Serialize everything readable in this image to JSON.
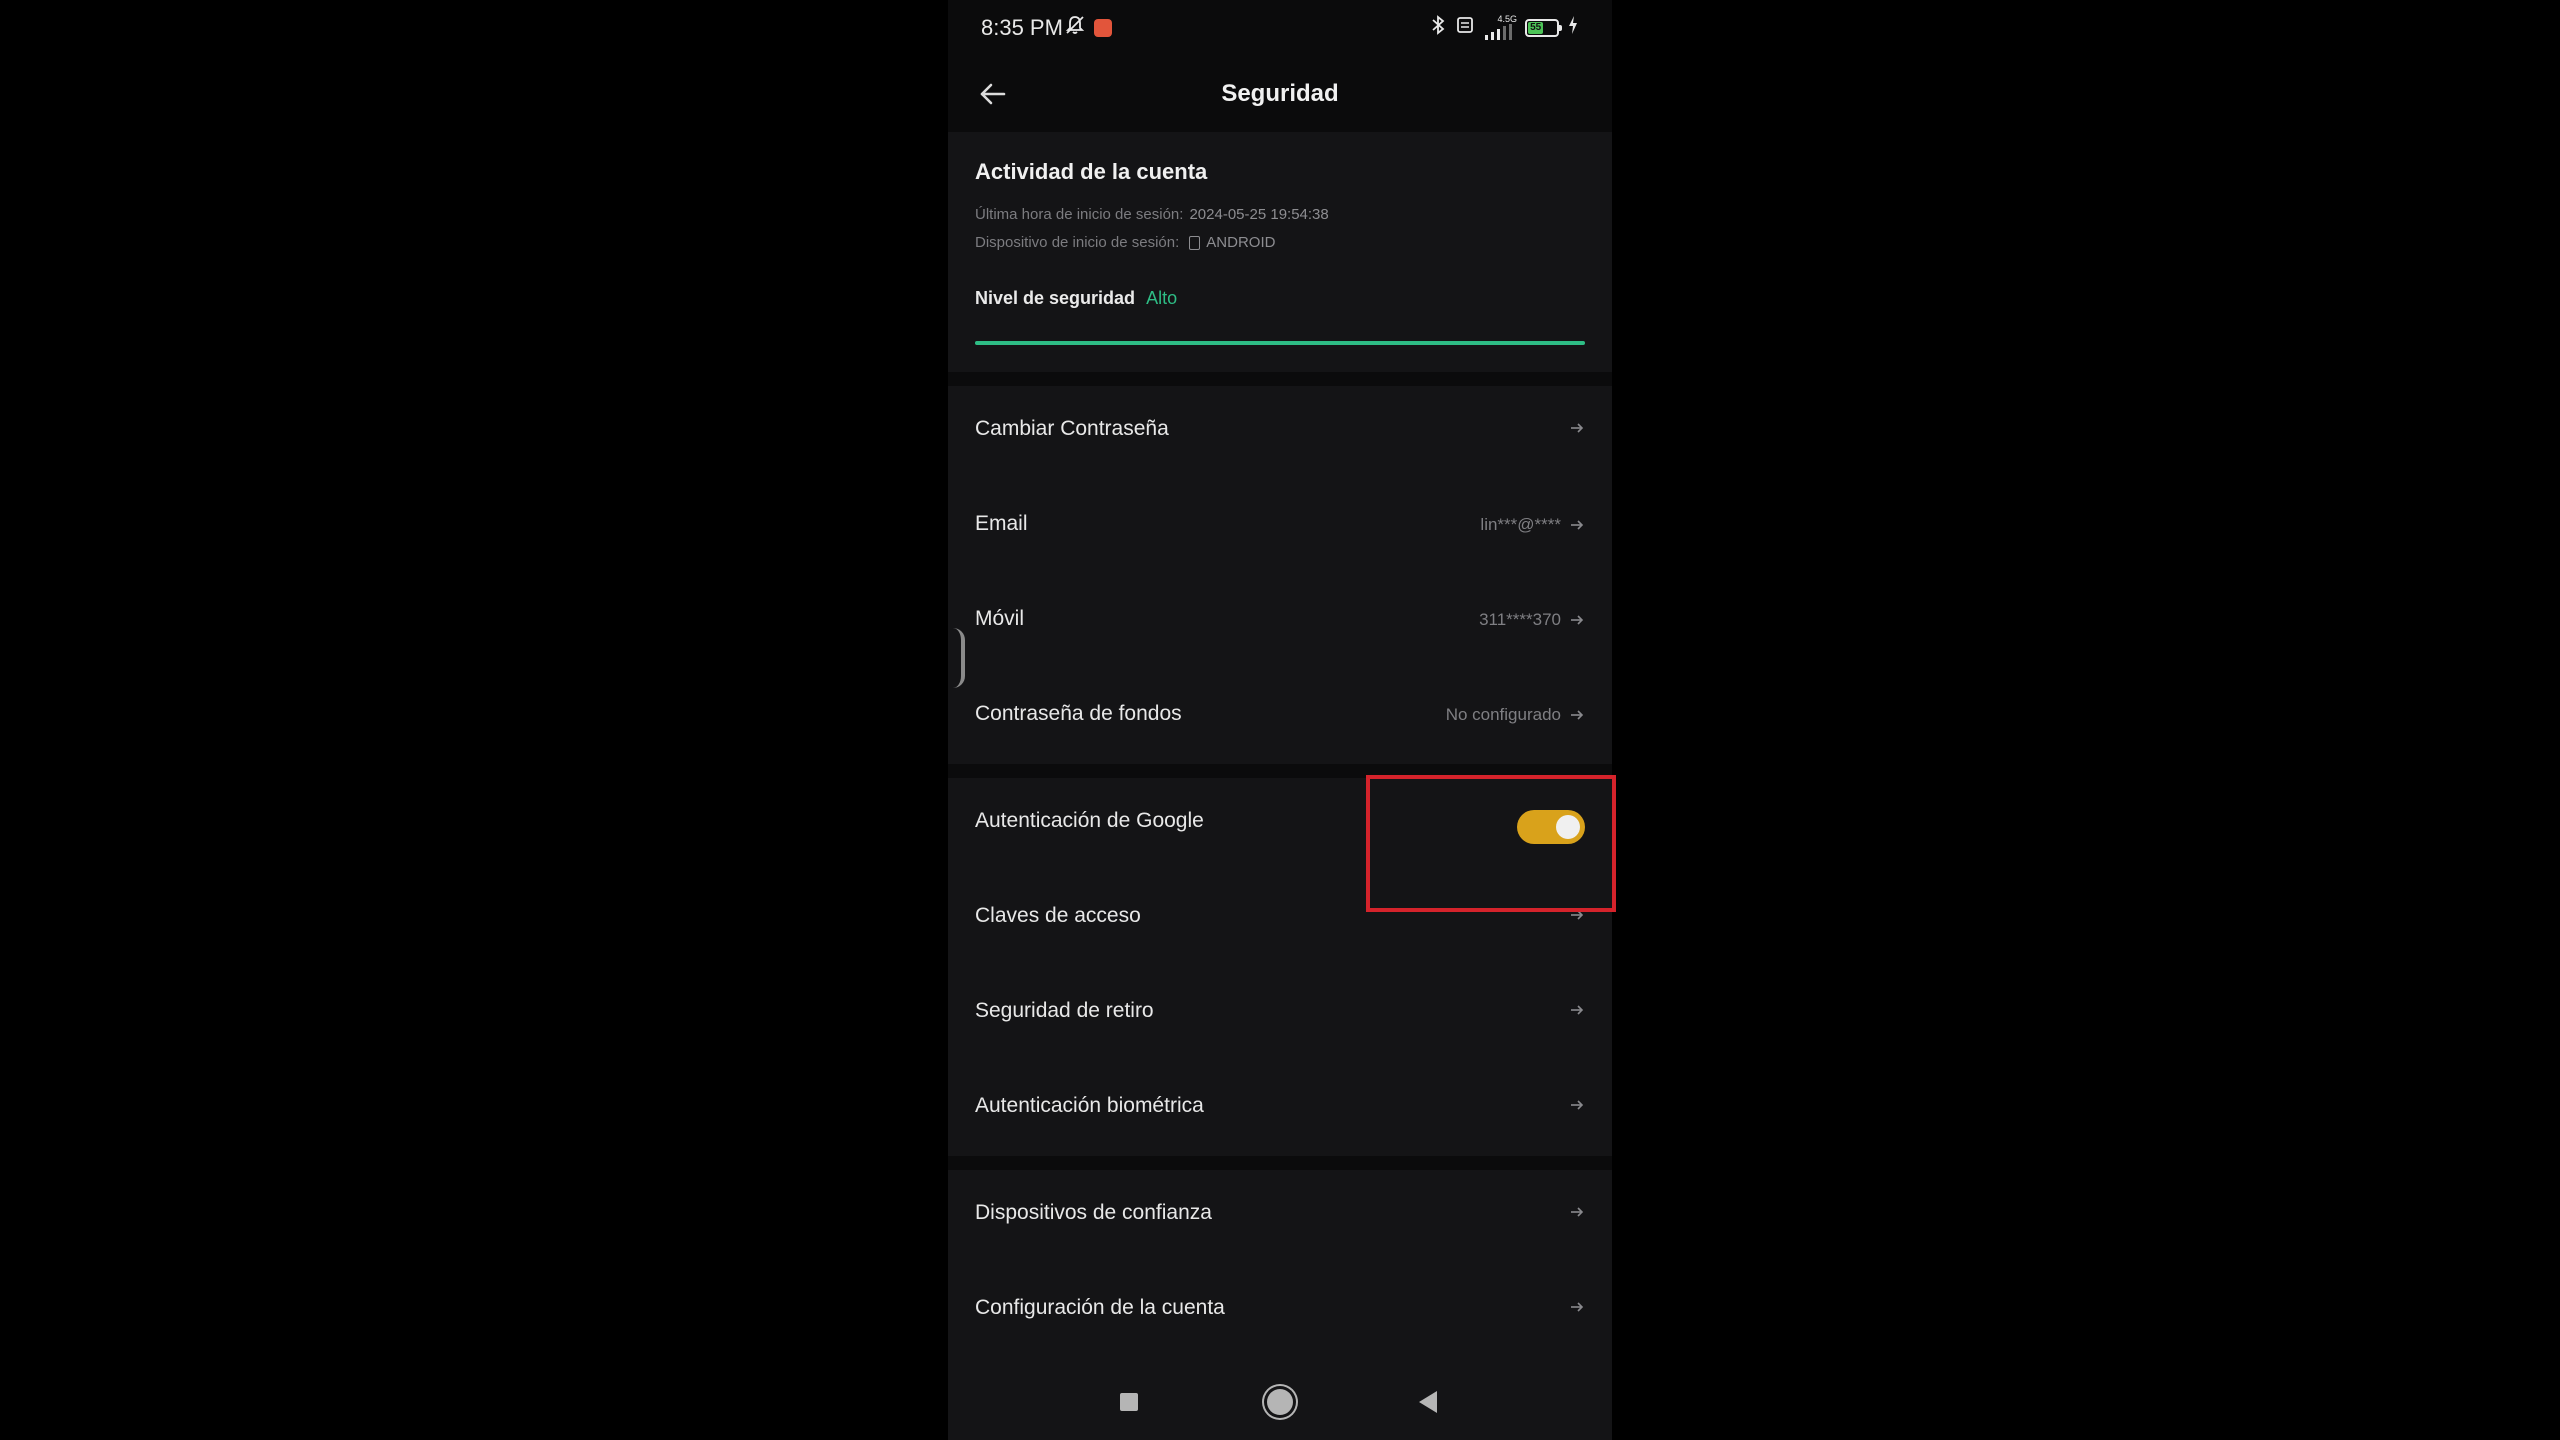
{
  "status_bar": {
    "time": "8:35 PM",
    "network": "4.5G",
    "battery": "55",
    "icons": [
      "mute-bell-icon",
      "recording-icon",
      "bluetooth-icon",
      "vibrate-icon",
      "signal-icon",
      "battery-icon",
      "charging-icon"
    ]
  },
  "header": {
    "title": "Seguridad",
    "back_icon": "arrow-left-icon"
  },
  "activity": {
    "title": "Actividad de la cuenta",
    "last_login_label": "Última hora de inicio de sesión:",
    "last_login_value": "2024-05-25 19:54:38",
    "device_label": "Dispositivo de inicio de sesión:",
    "device_value": "ANDROID",
    "security_level_label": "Nivel de seguridad",
    "security_level_value": "Alto",
    "security_level_progress": 1.0,
    "accent_color": "#2ebd85"
  },
  "group1": [
    {
      "label": "Cambiar Contraseña",
      "value": ""
    },
    {
      "label": "Email",
      "value": "lin***@****"
    },
    {
      "label": "Móvil",
      "value": "311****370"
    },
    {
      "label": "Contraseña de fondos",
      "value": "No configurado"
    }
  ],
  "group2": {
    "google_auth": {
      "label": "Autenticación de Google",
      "enabled": true,
      "toggle_color": "#d9a21b"
    },
    "items": [
      {
        "label": "Claves de acceso"
      },
      {
        "label": "Seguridad de retiro"
      },
      {
        "label": "Autenticación biométrica"
      }
    ]
  },
  "group3": [
    {
      "label": "Dispositivos de confianza"
    },
    {
      "label": "Configuración de la cuenta"
    }
  ],
  "annotation": {
    "color": "#d5232b"
  },
  "nav_bar": {
    "icons": [
      "recents-square-icon",
      "home-circle-icon",
      "back-triangle-icon"
    ]
  }
}
